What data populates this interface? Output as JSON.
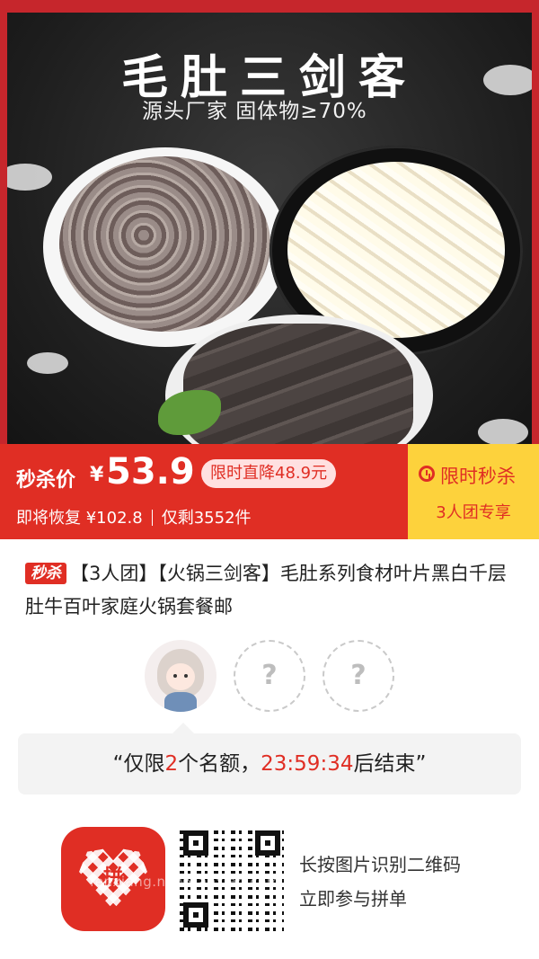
{
  "hero": {
    "title": "毛肚三剑客",
    "subtitle": "源头厂家 固体物≥70%"
  },
  "price_bar": {
    "flash_label": "秒杀价",
    "currency": "¥",
    "price": "53.9",
    "drop_badge": "限时直降48.9元",
    "restore_text": "即将恢复 ¥102.8",
    "stock_text": "仅剩3552件",
    "flash_sale_title": "限时秒杀",
    "group_only": "3人团专享"
  },
  "product": {
    "tag": "秒杀",
    "title": "【3人团】【火锅三剑客】毛肚系列食材叶片黑白千层肚牛百叶家庭火锅套餐邮"
  },
  "group": {
    "empty_slot_symbol": "?",
    "notice_prefix": "“仅限",
    "notice_count": "2",
    "notice_middle": "个名额，",
    "notice_time": "23:59:34",
    "notice_suffix": "后结束”"
  },
  "footer": {
    "logo_char": "拼",
    "watermark": "fenxiang.newxiaoxiao.com",
    "scan_line1": "长按图片识别二维码",
    "scan_line2": "立即参与拼单"
  },
  "colors": {
    "brand_red": "#e02e24",
    "flash_yellow": "#fdd23c",
    "notice_bg": "#f3f3f3"
  }
}
